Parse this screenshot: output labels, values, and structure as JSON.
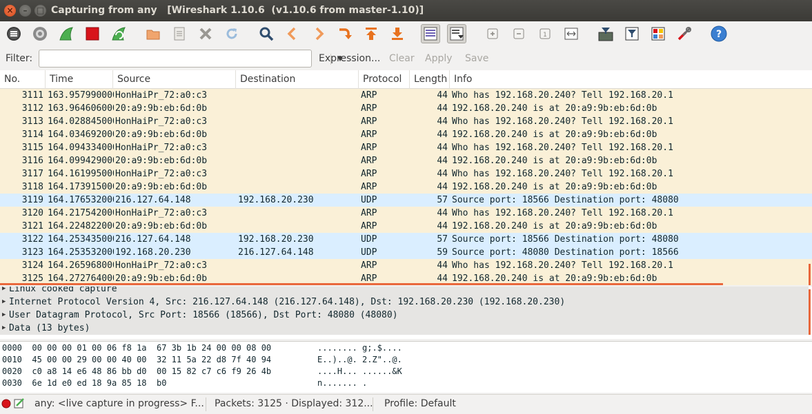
{
  "window": {
    "title": "Capturing from any   [Wireshark 1.10.6  (v1.10.6 from master-1.10)]"
  },
  "toolbar": {
    "icons": [
      "interfaces-icon",
      "options-icon",
      "start-capture-icon",
      "stop-capture-icon",
      "restart-capture-icon",
      "open-file-icon",
      "save-file-icon",
      "close-file-icon",
      "reload-icon",
      "find-packet-icon",
      "go-back-icon",
      "go-forward-icon",
      "go-to-packet-icon",
      "go-first-icon",
      "go-last-icon",
      "colorize-icon",
      "auto-scroll-icon",
      "zoom-in-icon",
      "zoom-out-icon",
      "normal-size-icon",
      "resize-columns-icon",
      "capture-filters-icon",
      "display-filters-icon",
      "coloring-rules-icon",
      "preferences-icon",
      "help-icon"
    ]
  },
  "filter": {
    "label": "Filter:",
    "value": "",
    "expression_label": "Expression...",
    "clear_label": "Clear",
    "apply_label": "Apply",
    "save_label": "Save"
  },
  "columns": {
    "no": "No.",
    "time": "Time",
    "source": "Source",
    "destination": "Destination",
    "protocol": "Protocol",
    "length": "Length",
    "info": "Info"
  },
  "packets": [
    {
      "no": "3111",
      "time": "163.957990000",
      "source": "HonHaiPr_72:a0:c3",
      "destination": "",
      "protocol": "ARP",
      "length": "44",
      "info": "Who has 192.168.20.240?  Tell 192.168.20.1",
      "kind": "arp"
    },
    {
      "no": "3112",
      "time": "163.964606000",
      "source": "20:a9:9b:eb:6d:0b",
      "destination": "",
      "protocol": "ARP",
      "length": "44",
      "info": "192.168.20.240 is at 20:a9:9b:eb:6d:0b",
      "kind": "arp"
    },
    {
      "no": "3113",
      "time": "164.028845000",
      "source": "HonHaiPr_72:a0:c3",
      "destination": "",
      "protocol": "ARP",
      "length": "44",
      "info": "Who has 192.168.20.240?  Tell 192.168.20.1",
      "kind": "arp"
    },
    {
      "no": "3114",
      "time": "164.034692000",
      "source": "20:a9:9b:eb:6d:0b",
      "destination": "",
      "protocol": "ARP",
      "length": "44",
      "info": "192.168.20.240 is at 20:a9:9b:eb:6d:0b",
      "kind": "arp"
    },
    {
      "no": "3115",
      "time": "164.094334000",
      "source": "HonHaiPr_72:a0:c3",
      "destination": "",
      "protocol": "ARP",
      "length": "44",
      "info": "Who has 192.168.20.240?  Tell 192.168.20.1",
      "kind": "arp"
    },
    {
      "no": "3116",
      "time": "164.099429000",
      "source": "20:a9:9b:eb:6d:0b",
      "destination": "",
      "protocol": "ARP",
      "length": "44",
      "info": "192.168.20.240 is at 20:a9:9b:eb:6d:0b",
      "kind": "arp"
    },
    {
      "no": "3117",
      "time": "164.161995000",
      "source": "HonHaiPr_72:a0:c3",
      "destination": "",
      "protocol": "ARP",
      "length": "44",
      "info": "Who has 192.168.20.240?  Tell 192.168.20.1",
      "kind": "arp"
    },
    {
      "no": "3118",
      "time": "164.173915000",
      "source": "20:a9:9b:eb:6d:0b",
      "destination": "",
      "protocol": "ARP",
      "length": "44",
      "info": "192.168.20.240 is at 20:a9:9b:eb:6d:0b",
      "kind": "arp"
    },
    {
      "no": "3119",
      "time": "164.176532000",
      "source": "216.127.64.148",
      "destination": "192.168.20.230",
      "protocol": "UDP",
      "length": "57",
      "info": "Source port: 18566  Destination port: 48080",
      "kind": "udp"
    },
    {
      "no": "3120",
      "time": "164.217542000",
      "source": "HonHaiPr_72:a0:c3",
      "destination": "",
      "protocol": "ARP",
      "length": "44",
      "info": "Who has 192.168.20.240?  Tell 192.168.20.1",
      "kind": "arp"
    },
    {
      "no": "3121",
      "time": "164.224822000",
      "source": "20:a9:9b:eb:6d:0b",
      "destination": "",
      "protocol": "ARP",
      "length": "44",
      "info": "192.168.20.240 is at 20:a9:9b:eb:6d:0b",
      "kind": "arp"
    },
    {
      "no": "3122",
      "time": "164.253435000",
      "source": "216.127.64.148",
      "destination": "192.168.20.230",
      "protocol": "UDP",
      "length": "57",
      "info": "Source port: 18566  Destination port: 48080",
      "kind": "udp"
    },
    {
      "no": "3123",
      "time": "164.253532000",
      "source": "192.168.20.230",
      "destination": "216.127.64.148",
      "protocol": "UDP",
      "length": "59",
      "info": "Source port: 48080  Destination port: 18566",
      "kind": "udp"
    },
    {
      "no": "3124",
      "time": "164.265968000",
      "source": "HonHaiPr_72:a0:c3",
      "destination": "",
      "protocol": "ARP",
      "length": "44",
      "info": "Who has 192.168.20.240?  Tell 192.168.20.1",
      "kind": "arp"
    },
    {
      "no": "3125",
      "time": "164.272764000",
      "source": "20:a9:9b:eb:6d:0b",
      "destination": "",
      "protocol": "ARP",
      "length": "44",
      "info": "192.168.20.240 is at 20:a9:9b:eb:6d:0b",
      "kind": "arp"
    }
  ],
  "details": [
    "Linux cooked capture",
    "Internet Protocol Version 4, Src: 216.127.64.148 (216.127.64.148), Dst: 192.168.20.230 (192.168.20.230)",
    "User Datagram Protocol, Src Port: 18566 (18566), Dst Port: 48080 (48080)",
    "Data (13 bytes)"
  ],
  "hex": [
    {
      "offset": "0000",
      "bytes": "00 00 00 01 00 06 f8 1a  67 3b 1b 24 00 00 08 00",
      "ascii": "........ g;.$...."
    },
    {
      "offset": "0010",
      "bytes": "45 00 00 29 00 00 40 00  32 11 5a 22 d8 7f 40 94",
      "ascii": "E..)..@. 2.Z\"..@."
    },
    {
      "offset": "0020",
      "bytes": "c0 a8 14 e6 48 86 bb d0  00 15 82 c7 c6 f9 26 4b",
      "ascii": "....H... ......&K"
    },
    {
      "offset": "0030",
      "bytes": "6e 1d e0 ed 18 9a 85 18  b0",
      "ascii": "n....... ."
    }
  ],
  "status": {
    "capture": "any: <live capture in progress> F...",
    "packets": "Packets: 3125 · Displayed: 312...",
    "profile": "Profile: Default"
  },
  "colors": {
    "arp_row": "#faf0d7",
    "udp_row": "#daeeff",
    "accent": "#e9683c"
  }
}
